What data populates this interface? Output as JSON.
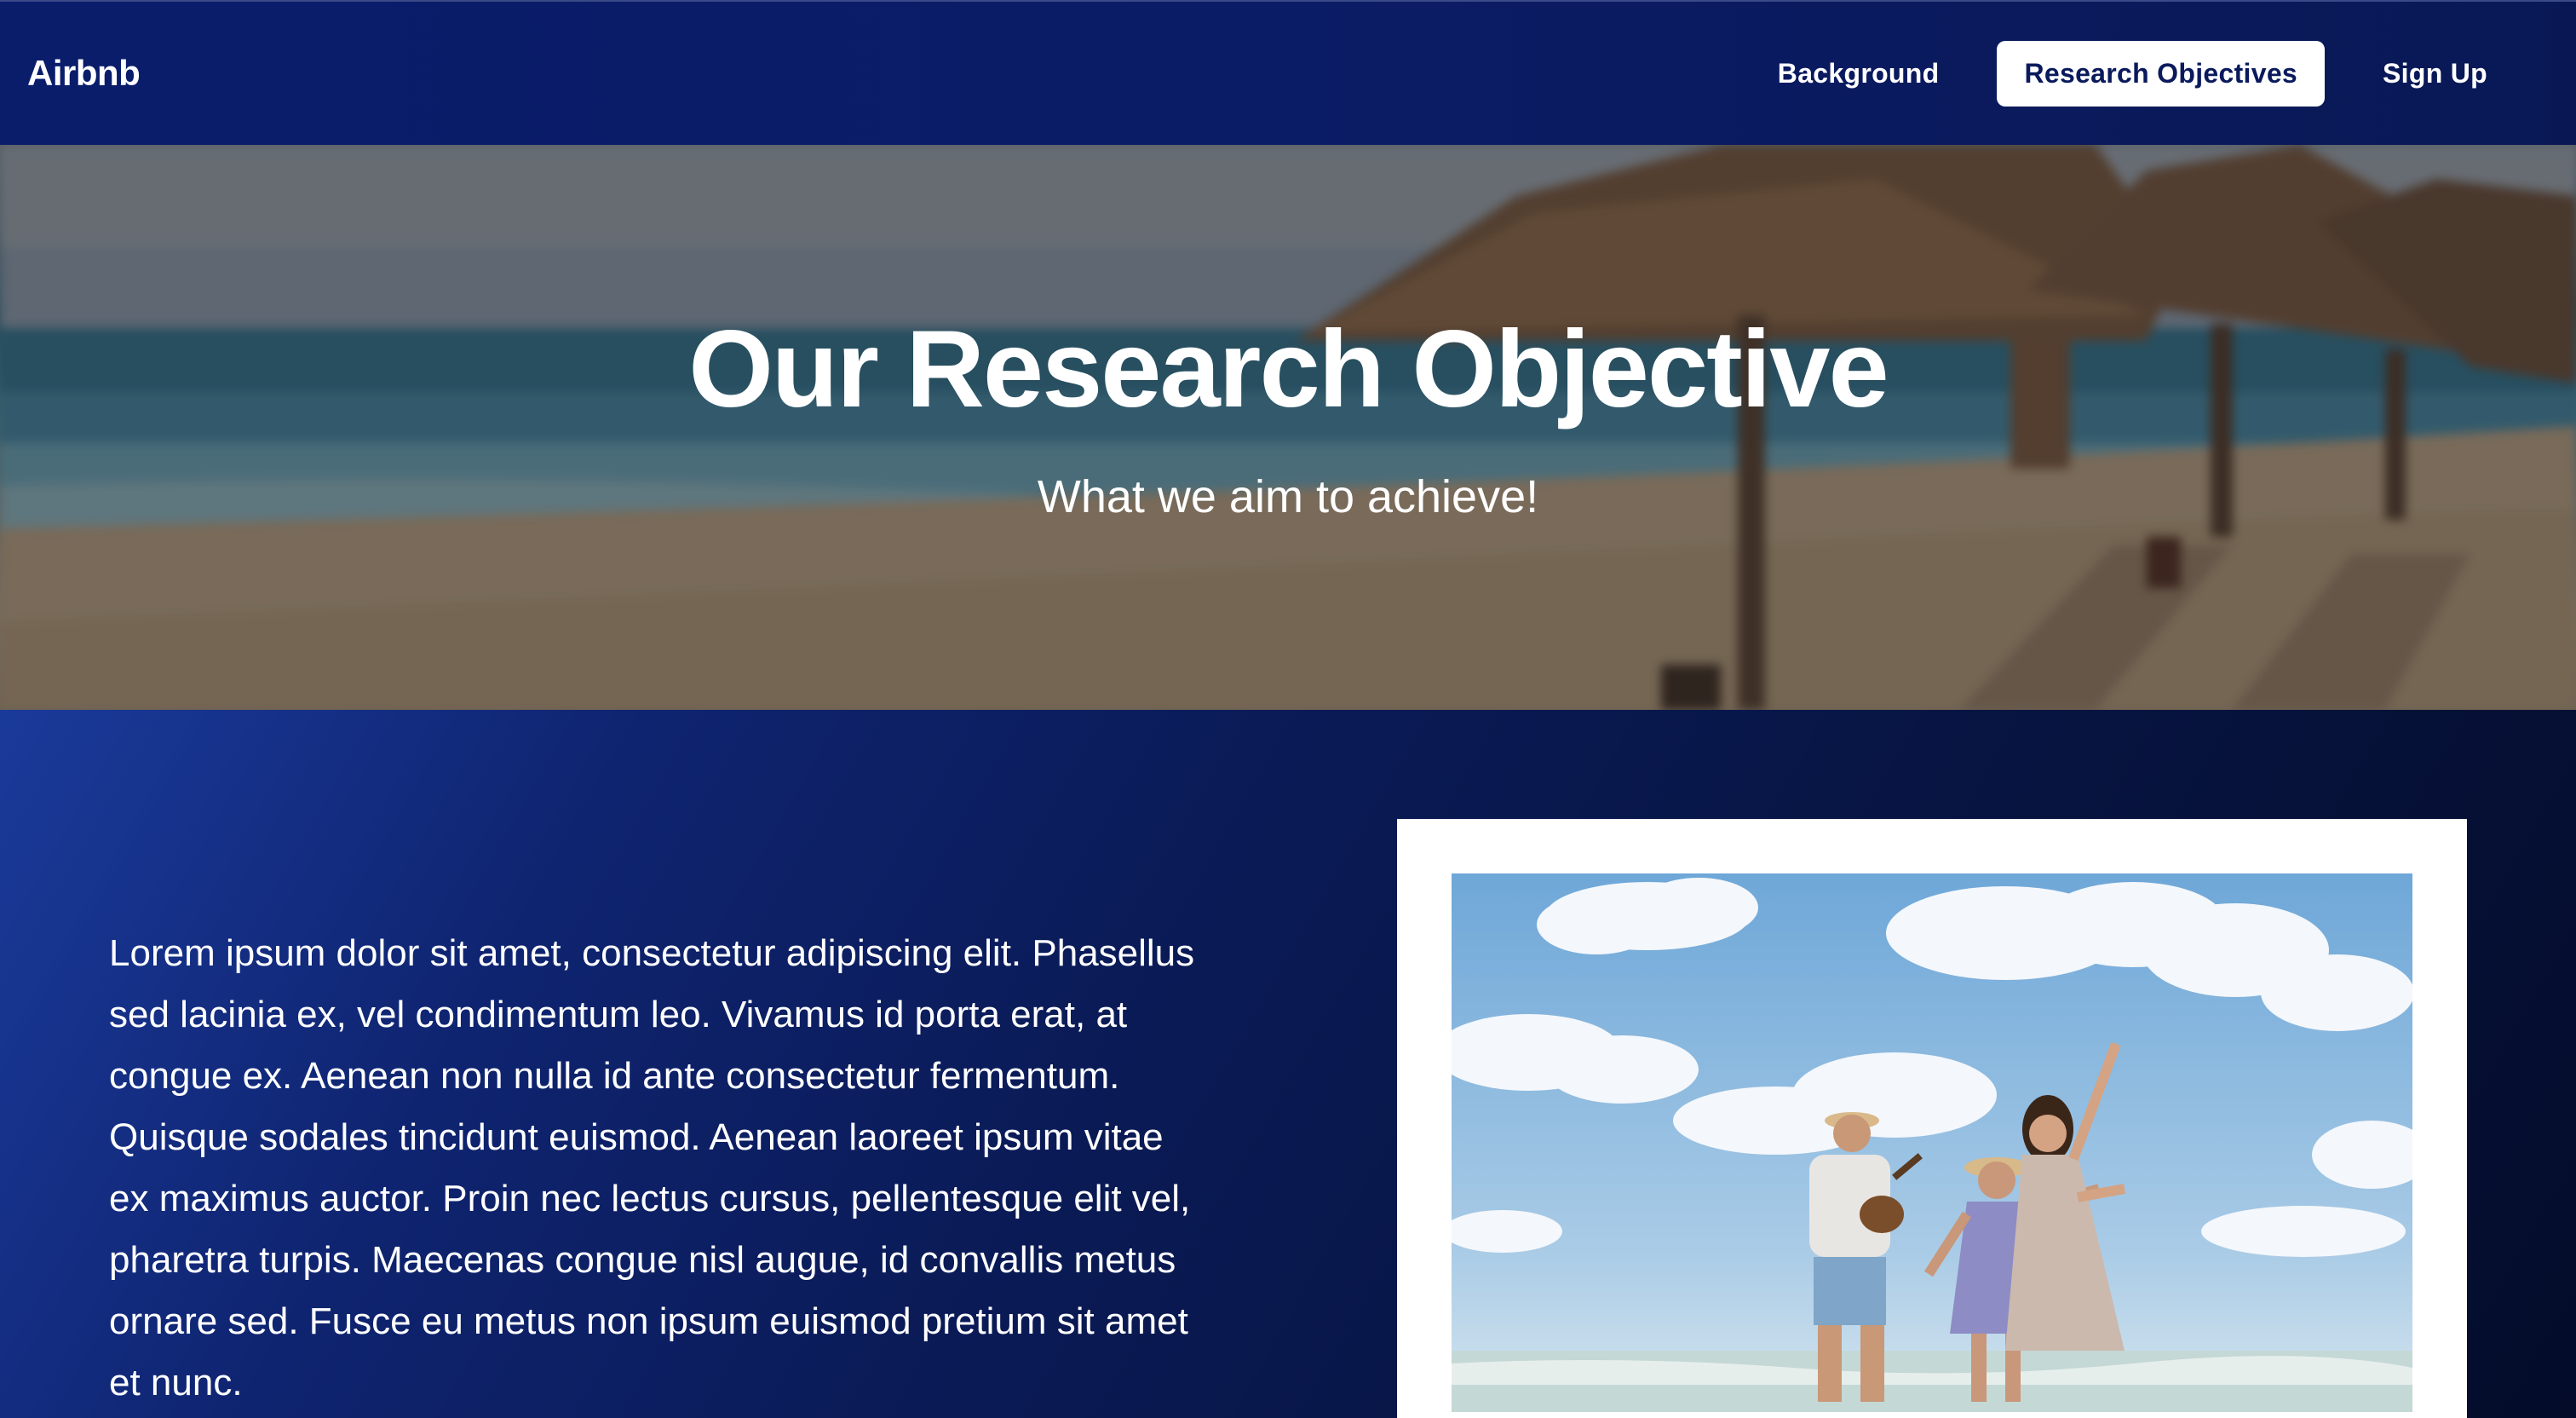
{
  "navbar": {
    "brand": "Airbnb",
    "links": [
      {
        "label": "Background",
        "active": false
      },
      {
        "label": "Research Objectives",
        "active": true
      },
      {
        "label": "Sign Up",
        "active": false
      }
    ]
  },
  "hero": {
    "title": "Our Research Objective",
    "subtitle": "What we aim to achieve!"
  },
  "content": {
    "paragraph": "Lorem ipsum dolor sit amet, consectetur adipiscing elit. Phasellus sed lacinia ex, vel condimentum leo. Vivamus id porta erat, at congue ex. Aenean non nulla id ante consectetur fermentum. Quisque sodales tincidunt euismod. Aenean laoreet ipsum vitae ex maximus auctor. Proin nec lectus cursus, pellentesque elit vel, pharetra turpis. Maecenas congue nisl augue, id convallis metus ornare sed. Fusce eu metus non ipsum euismod pretium sit amet et nunc."
  },
  "colors": {
    "navbar": "#0a1d6b",
    "accent_text": "#0a1a5c",
    "content_start": "#1a3a9a",
    "content_end": "#040c2a"
  }
}
